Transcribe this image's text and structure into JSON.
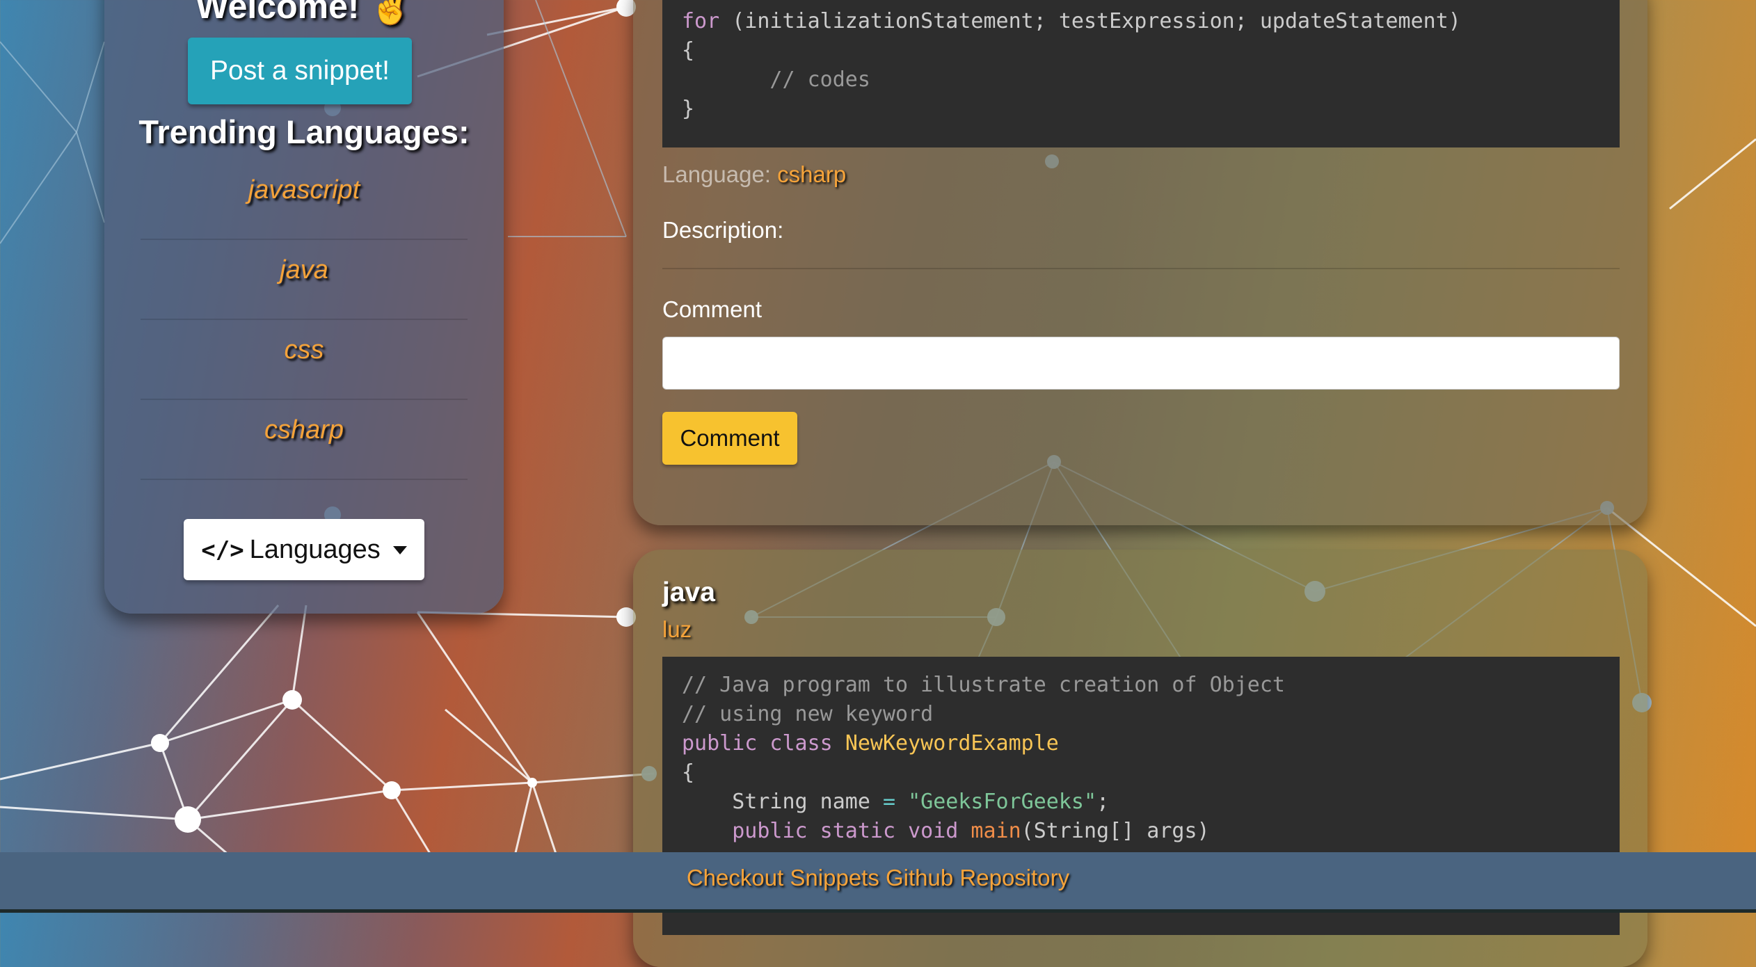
{
  "sidebar": {
    "welcome_text": "Welcome! ✌️",
    "post_button_label": "Post a snippet!",
    "trending_title": "Trending Languages:",
    "trending_languages": [
      "javascript",
      "java",
      "css",
      "csharp"
    ],
    "languages_dropdown_label": "Languages",
    "languages_dropdown_icon": "code-icon"
  },
  "snippets": [
    {
      "code_lines": [
        "for (initializationStatement; testExpression; updateStatement)",
        "{",
        "       // codes",
        "}"
      ],
      "language_label": "Language:",
      "language": "csharp",
      "description_label": "Description:",
      "comment_label": "Comment",
      "comment_value": "",
      "comment_button_label": "Comment"
    },
    {
      "language": "java",
      "user": "luz",
      "code_lines": [
        "// Java program to illustrate creation of Object",
        "// using new keyword",
        "public class NewKeywordExample",
        "{",
        "    String name = \"GeeksForGeeks\";",
        "    public static void main(String[] args)"
      ]
    }
  ],
  "footer": {
    "link_text": "Checkout Snippets Github Repository"
  },
  "colors": {
    "accent_orange": "#f5a33a",
    "post_button": "#25a2b8",
    "comment_button": "#f7c22f",
    "footer_bg": "#4a6480",
    "code_bg": "#2d2d2d"
  }
}
